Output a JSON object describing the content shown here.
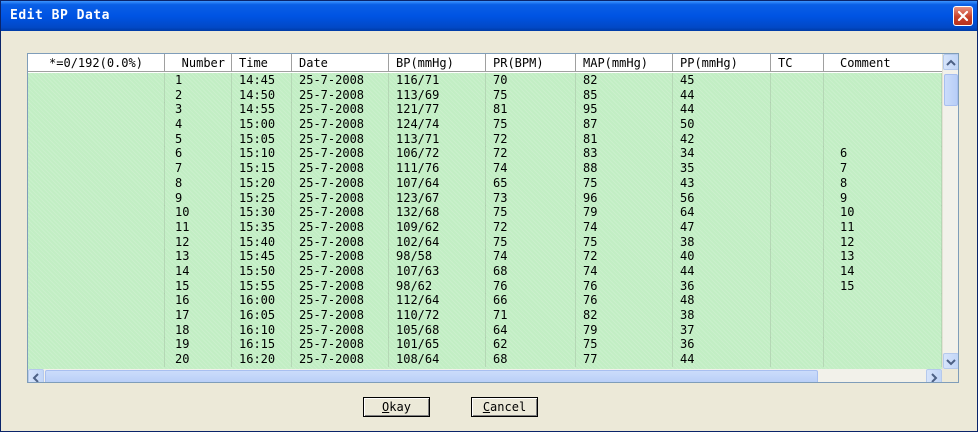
{
  "window": {
    "title": "Edit BP Data"
  },
  "grid": {
    "columns": [
      "*=0/192(0.0%)",
      "Number",
      "Time",
      "Date",
      "BP(mmHg)",
      "PR(BPM)",
      "MAP(mmHg)",
      "PP(mmHg)",
      "TC",
      "Comment"
    ],
    "rows": [
      {
        "number": "1",
        "time": "14:45",
        "date": "25-7-2008",
        "bp": "116/71",
        "pr": "70",
        "map": "82",
        "pp": "45",
        "tc": "",
        "comment": ""
      },
      {
        "number": "2",
        "time": "14:50",
        "date": "25-7-2008",
        "bp": "113/69",
        "pr": "75",
        "map": "85",
        "pp": "44",
        "tc": "",
        "comment": ""
      },
      {
        "number": "3",
        "time": "14:55",
        "date": "25-7-2008",
        "bp": "121/77",
        "pr": "81",
        "map": "95",
        "pp": "44",
        "tc": "",
        "comment": ""
      },
      {
        "number": "4",
        "time": "15:00",
        "date": "25-7-2008",
        "bp": "124/74",
        "pr": "75",
        "map": "87",
        "pp": "50",
        "tc": "",
        "comment": ""
      },
      {
        "number": "5",
        "time": "15:05",
        "date": "25-7-2008",
        "bp": "113/71",
        "pr": "72",
        "map": "81",
        "pp": "42",
        "tc": "",
        "comment": ""
      },
      {
        "number": "6",
        "time": "15:10",
        "date": "25-7-2008",
        "bp": "106/72",
        "pr": "72",
        "map": "83",
        "pp": "34",
        "tc": "",
        "comment": "6"
      },
      {
        "number": "7",
        "time": "15:15",
        "date": "25-7-2008",
        "bp": "111/76",
        "pr": "74",
        "map": "88",
        "pp": "35",
        "tc": "",
        "comment": "7"
      },
      {
        "number": "8",
        "time": "15:20",
        "date": "25-7-2008",
        "bp": "107/64",
        "pr": "65",
        "map": "75",
        "pp": "43",
        "tc": "",
        "comment": "8"
      },
      {
        "number": "9",
        "time": "15:25",
        "date": "25-7-2008",
        "bp": "123/67",
        "pr": "73",
        "map": "96",
        "pp": "56",
        "tc": "",
        "comment": "9"
      },
      {
        "number": "10",
        "time": "15:30",
        "date": "25-7-2008",
        "bp": "132/68",
        "pr": "75",
        "map": "79",
        "pp": "64",
        "tc": "",
        "comment": "10"
      },
      {
        "number": "11",
        "time": "15:35",
        "date": "25-7-2008",
        "bp": "109/62",
        "pr": "72",
        "map": "74",
        "pp": "47",
        "tc": "",
        "comment": "11"
      },
      {
        "number": "12",
        "time": "15:40",
        "date": "25-7-2008",
        "bp": "102/64",
        "pr": "75",
        "map": "75",
        "pp": "38",
        "tc": "",
        "comment": "12"
      },
      {
        "number": "13",
        "time": "15:45",
        "date": "25-7-2008",
        "bp": "98/58",
        "pr": "74",
        "map": "72",
        "pp": "40",
        "tc": "",
        "comment": "13"
      },
      {
        "number": "14",
        "time": "15:50",
        "date": "25-7-2008",
        "bp": "107/63",
        "pr": "68",
        "map": "74",
        "pp": "44",
        "tc": "",
        "comment": "14"
      },
      {
        "number": "15",
        "time": "15:55",
        "date": "25-7-2008",
        "bp": "98/62",
        "pr": "76",
        "map": "76",
        "pp": "36",
        "tc": "",
        "comment": "15"
      },
      {
        "number": "16",
        "time": "16:00",
        "date": "25-7-2008",
        "bp": "112/64",
        "pr": "66",
        "map": "76",
        "pp": "48",
        "tc": "",
        "comment": ""
      },
      {
        "number": "17",
        "time": "16:05",
        "date": "25-7-2008",
        "bp": "110/72",
        "pr": "71",
        "map": "82",
        "pp": "38",
        "tc": "",
        "comment": ""
      },
      {
        "number": "18",
        "time": "16:10",
        "date": "25-7-2008",
        "bp": "105/68",
        "pr": "64",
        "map": "79",
        "pp": "37",
        "tc": "",
        "comment": ""
      },
      {
        "number": "19",
        "time": "16:15",
        "date": "25-7-2008",
        "bp": "101/65",
        "pr": "62",
        "map": "75",
        "pp": "36",
        "tc": "",
        "comment": ""
      },
      {
        "number": "20",
        "time": "16:20",
        "date": "25-7-2008",
        "bp": "108/64",
        "pr": "68",
        "map": "77",
        "pp": "44",
        "tc": "",
        "comment": ""
      }
    ]
  },
  "buttons": {
    "okay_mnemonic": "O",
    "okay_rest": "kay",
    "cancel_mnemonic": "C",
    "cancel_rest": "ancel"
  },
  "icons": {
    "close": "close-icon",
    "scroll_up": "arrow-up-icon",
    "scroll_down": "arrow-down-icon",
    "scroll_left": "arrow-left-icon",
    "scroll_right": "arrow-right-icon"
  },
  "colors": {
    "titlebar": "#0054e3",
    "grid_background": "#c2eec4",
    "dialog_face": "#ece9d8",
    "close_button": "#c8412a"
  }
}
